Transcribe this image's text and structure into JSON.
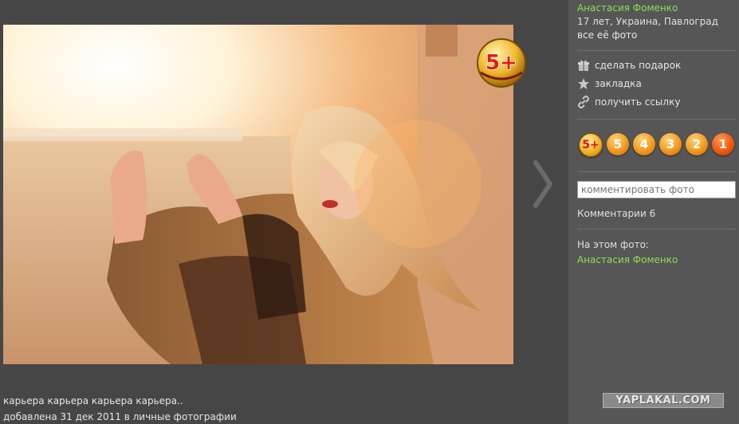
{
  "author": {
    "name": "Анастасия Фоменко",
    "info": "17 лет, Украина, Павлоград",
    "all_photos": "все её фото"
  },
  "actions": [
    {
      "label": "сделать подарок",
      "icon": "gift-icon"
    },
    {
      "label": "закладка",
      "icon": "star-icon"
    },
    {
      "label": "получить ссылку",
      "icon": "link-icon"
    }
  ],
  "ratings": [
    "5+",
    "5",
    "4",
    "3",
    "2",
    "1"
  ],
  "photo_badge": "5+",
  "comment": {
    "placeholder": "комментировать фото",
    "count_label": "Комментарии 6"
  },
  "on_photo": {
    "label": "На этом фото:",
    "person": "Анастасия Фоменко"
  },
  "photo": {
    "caption": "карьера карьера карьера карьера..",
    "added_prefix": "добавлена 31 дек 2011 в ",
    "album": "личные фотографии"
  },
  "site_logo": "YAPLAKAL.COM",
  "colors": {
    "viewer_bg": "#464646",
    "sidebar_bg": "#565656",
    "link_green": "#8ddd55",
    "rating_orange": "#f39a1d"
  }
}
